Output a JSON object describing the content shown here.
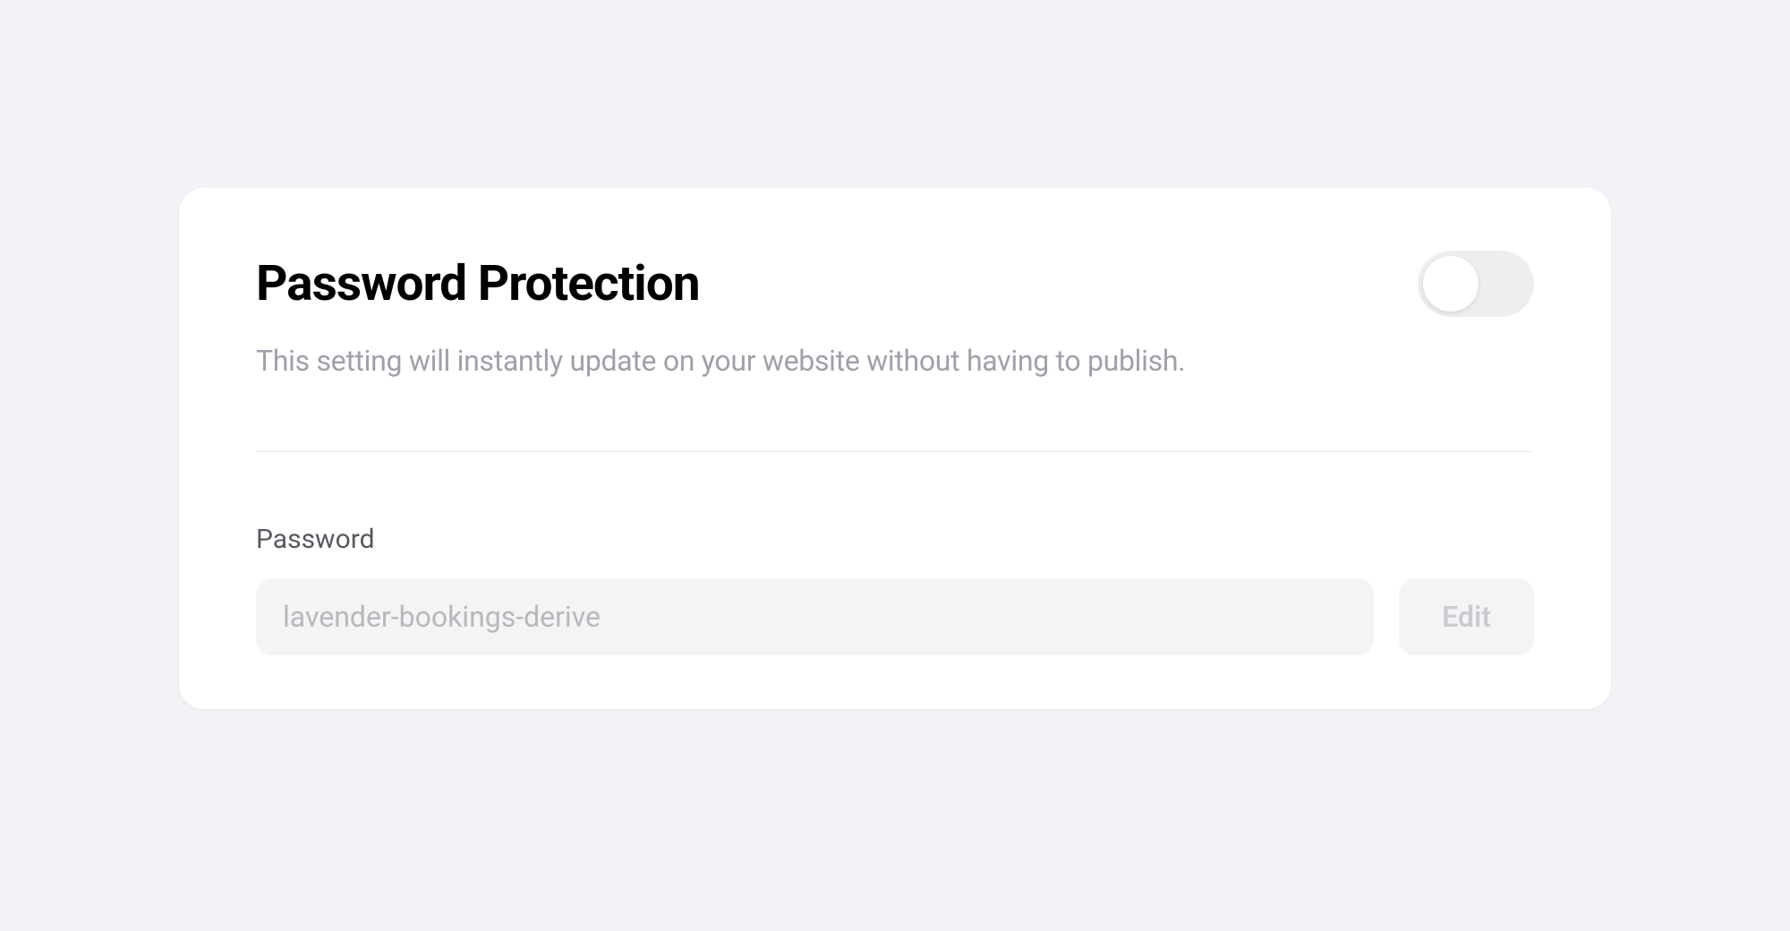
{
  "card": {
    "title": "Password Protection",
    "description": "This setting will instantly update on your website without having to publish.",
    "toggle_enabled": false,
    "password": {
      "label": "Password",
      "value": "lavender-bookings-derive",
      "edit_label": "Edit"
    }
  }
}
